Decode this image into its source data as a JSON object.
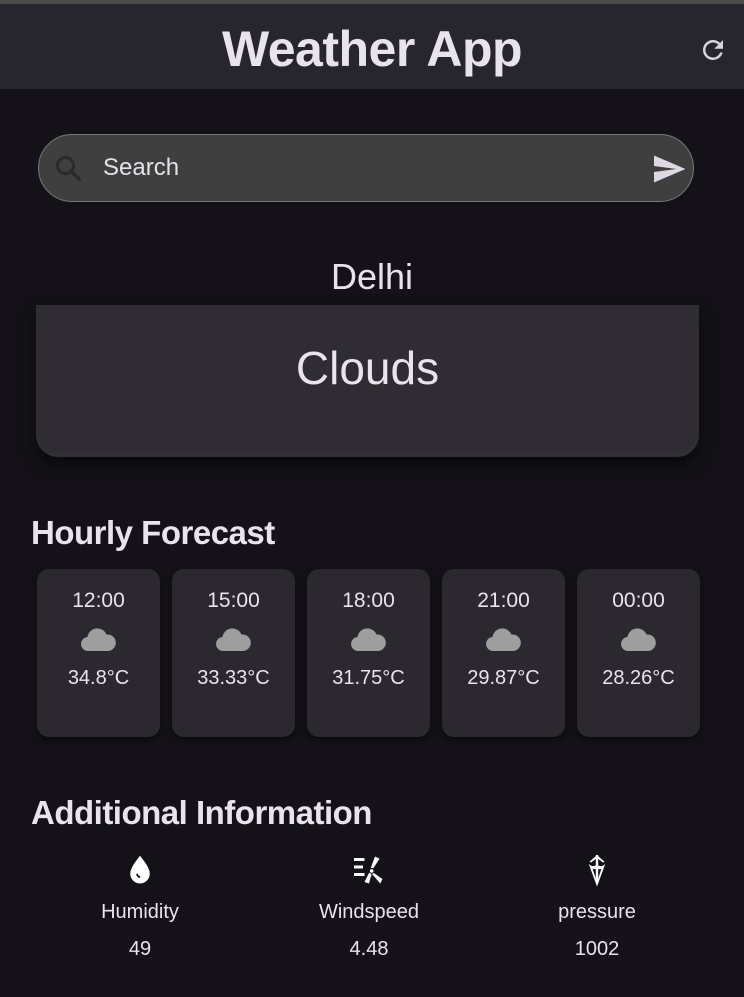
{
  "app": {
    "title": "Weather App",
    "refresh_icon": "refresh-icon"
  },
  "search": {
    "placeholder": "Search",
    "value": "",
    "search_icon": "search-icon",
    "send_icon": "send-icon"
  },
  "current": {
    "city": "Delhi",
    "condition": "Clouds"
  },
  "hourly": {
    "title": "Hourly Forecast",
    "items": [
      {
        "time": "12:00",
        "icon": "cloud-icon",
        "temp": "34.8°C"
      },
      {
        "time": "15:00",
        "icon": "cloud-icon",
        "temp": "33.33°C"
      },
      {
        "time": "18:00",
        "icon": "cloud-icon",
        "temp": "31.75°C"
      },
      {
        "time": "21:00",
        "icon": "cloud-icon",
        "temp": "29.87°C"
      },
      {
        "time": "00:00",
        "icon": "cloud-icon",
        "temp": "28.26°C"
      }
    ]
  },
  "additional": {
    "title": "Additional Information",
    "items": [
      {
        "label": "Humidity",
        "value": "49",
        "icon": "water-drop-icon"
      },
      {
        "label": "Windspeed",
        "value": "4.48",
        "icon": "wind-turbine-icon"
      },
      {
        "label": "pressure",
        "value": "1002",
        "icon": "umbrella-icon"
      }
    ]
  },
  "colors": {
    "background": "#141218",
    "appbar": "#27252d",
    "card": "#2b292f",
    "text": "#e8e3ec"
  }
}
